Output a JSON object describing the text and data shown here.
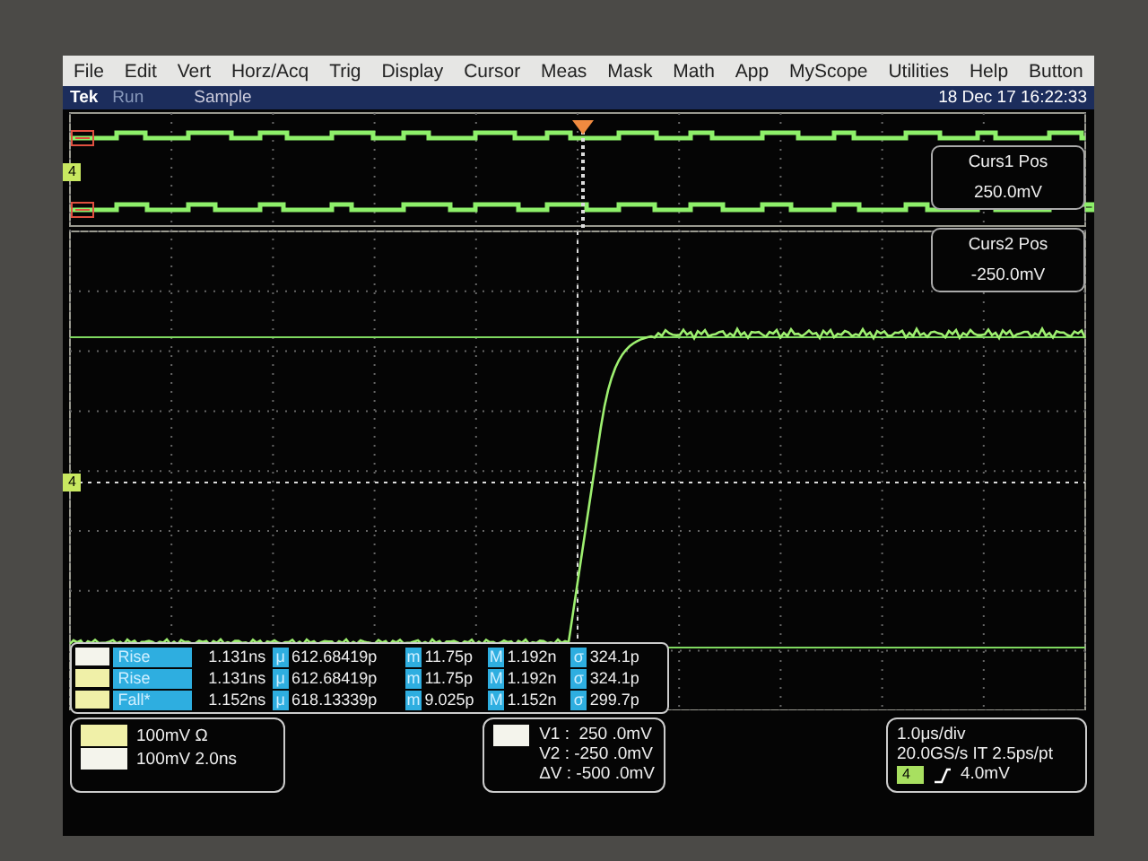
{
  "menu": [
    "File",
    "Edit",
    "Vert",
    "Horz/Acq",
    "Trig",
    "Display",
    "Cursor",
    "Meas",
    "Mask",
    "Math",
    "App",
    "MyScope",
    "Utilities",
    "Help",
    "Button"
  ],
  "status": {
    "brand": "Tek",
    "state": "Run",
    "mode": "Sample",
    "datetime": "18 Dec 17 16:22:33"
  },
  "channel_markers": [
    "4",
    "4"
  ],
  "cursor_readouts": [
    {
      "label": "Curs1 Pos",
      "value": "250.0mV"
    },
    {
      "label": "Curs2 Pos",
      "value": "-250.0mV"
    }
  ],
  "measurements": [
    {
      "name": "Rise",
      "value": "1.131ns",
      "stats": [
        {
          "symbol": "μ",
          "value": "612.68419p"
        },
        {
          "symbol": "m",
          "value": "11.75p"
        },
        {
          "symbol": "M",
          "value": "1.192n"
        },
        {
          "symbol": "σ",
          "value": "324.1p"
        }
      ]
    },
    {
      "name": "Rise",
      "value": "1.131ns",
      "stats": [
        {
          "symbol": "μ",
          "value": "612.68419p"
        },
        {
          "symbol": "m",
          "value": "11.75p"
        },
        {
          "symbol": "M",
          "value": "1.192n"
        },
        {
          "symbol": "σ",
          "value": "324.1p"
        }
      ]
    },
    {
      "name": "Fall*",
      "value": "1.152ns",
      "stats": [
        {
          "symbol": "μ",
          "value": "618.13339p"
        },
        {
          "symbol": "m",
          "value": "9.025p"
        },
        {
          "symbol": "M",
          "value": "1.152n"
        },
        {
          "symbol": "σ",
          "value": "299.7p"
        }
      ]
    }
  ],
  "channel_settings": [
    "100mV Ω",
    "100mV 2.0ns"
  ],
  "cursor_values": [
    "V1 :  250 .0mV",
    "V2 : -250 .0mV",
    "ΔV : -500 .0mV"
  ],
  "timebase": [
    "1.0μs/div",
    "20.0GS/s IT 2.5ps/pt"
  ],
  "trigger": {
    "source": "4",
    "level": "4.0mV"
  }
}
